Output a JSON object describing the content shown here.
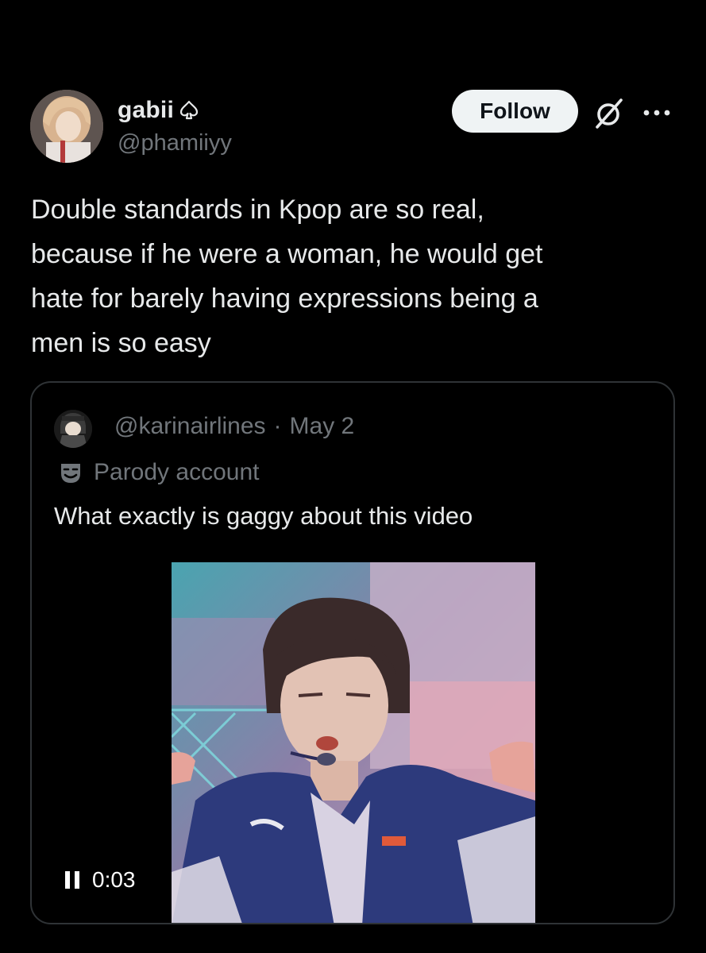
{
  "post": {
    "author": {
      "display_name": "gabii",
      "badge_icon": "spade-outline-icon",
      "handle": "@phamiiyy"
    },
    "actions": {
      "follow_label": "Follow",
      "grok_icon": "grok-icon",
      "more_icon": "more-dots-icon"
    },
    "text": "Double standards in Kpop are so real,\nbecause if he were a woman, he would get\nhate for barely having expressions being a\nmen is so easy"
  },
  "quote": {
    "handle": "@karinairlines",
    "separator": "·",
    "date": "May 2",
    "parody_icon": "theater-mask-icon",
    "parody_label": "Parody account",
    "text": "What exactly is gaggy about this video",
    "video": {
      "state_icon": "pause-icon",
      "time": "0:03"
    }
  },
  "colors": {
    "background": "#000000",
    "primary_text": "#e7e9ea",
    "secondary_text": "#71767b",
    "border": "#2f3336",
    "follow_bg": "#eff3f4"
  }
}
